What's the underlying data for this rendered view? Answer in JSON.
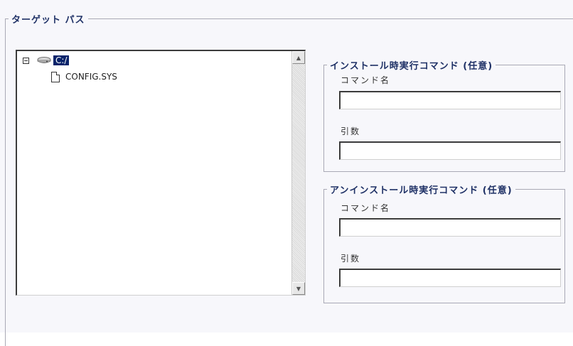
{
  "target_path": {
    "legend": "ターゲット パス",
    "tree": {
      "root": {
        "label": "C:/",
        "expanded": true,
        "selected": true
      },
      "children": [
        {
          "label": "CONFIG.SYS"
        }
      ]
    }
  },
  "install_group": {
    "legend": "インストール時実行コマンド (任意)",
    "command_label": "コマンド名",
    "command_value": "",
    "args_label": "引数",
    "args_value": ""
  },
  "uninstall_group": {
    "legend": "アンインストール時実行コマンド (任意)",
    "command_label": "コマンド名",
    "command_value": "",
    "args_label": "引数",
    "args_value": ""
  },
  "colors": {
    "legend_text": "#1f3166",
    "selection": "#0a246a"
  },
  "icons": {
    "expander": "minus-box-icon",
    "drive": "hard-drive-icon",
    "file": "file-icon",
    "scroll_up": "arrow-up-icon",
    "scroll_down": "arrow-down-icon"
  }
}
